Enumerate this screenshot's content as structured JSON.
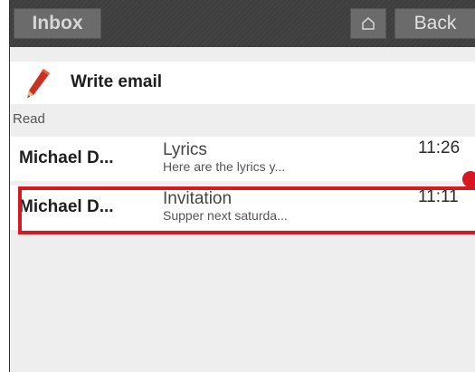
{
  "header": {
    "inbox_label": "Inbox",
    "home_icon": "home-icon",
    "back_label": "Back"
  },
  "compose": {
    "icon": "pencil-icon",
    "label": "Write email"
  },
  "section": {
    "label": "Read"
  },
  "emails": [
    {
      "sender": "Michael D...",
      "subject": "Lyrics",
      "preview": "Here are the lyrics y...",
      "time": "11:26"
    },
    {
      "sender": "Michael D...",
      "subject": "Invitation",
      "preview": "Supper next saturda...",
      "time": "11:11"
    }
  ],
  "colors": {
    "topbar": "#3f3f3f",
    "button": "#6b6b6b",
    "highlight": "#d61920",
    "background": "#eeeeee"
  }
}
